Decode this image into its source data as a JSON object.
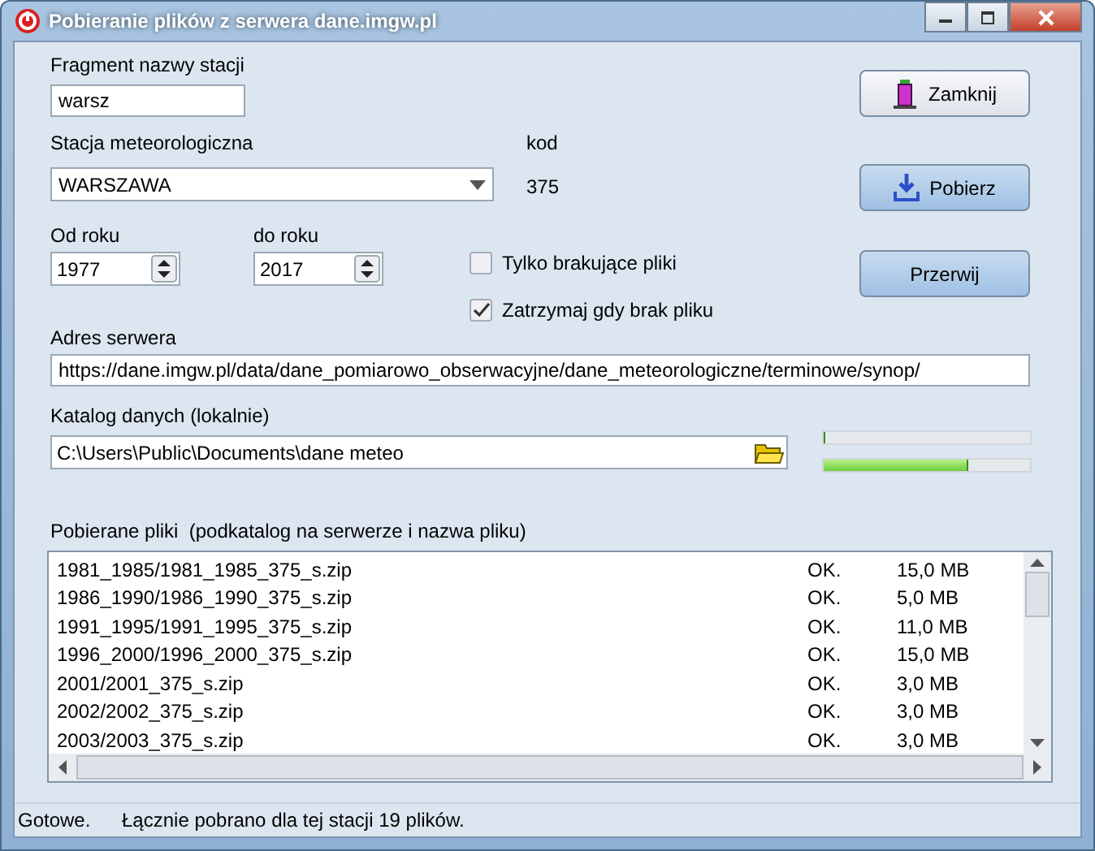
{
  "window": {
    "title": "Pobieranie plików z serwera dane.imgw.pl"
  },
  "station_filter": {
    "label": "Fragment nazwy stacji",
    "value": "warsz"
  },
  "station": {
    "label": "Stacja meteorologiczna",
    "value": "WARSZAWA"
  },
  "code": {
    "label": "kod",
    "value": "375"
  },
  "from_year": {
    "label": "Od roku",
    "value": "1977"
  },
  "to_year": {
    "label": "do roku",
    "value": "2017"
  },
  "options": [
    {
      "label": "Tylko brakujące pliki",
      "checked": false
    },
    {
      "label": "Zatrzymaj gdy brak pliku",
      "checked": true
    }
  ],
  "buttons": [
    {
      "label": "Zamknij",
      "kind": "close"
    },
    {
      "label": "Pobierz",
      "kind": "download"
    },
    {
      "label": "Przerwij",
      "kind": "stop"
    }
  ],
  "server": {
    "label": "Adres serwera",
    "value": "https://dane.imgw.pl/data/dane_pomiarowo_obserwacyjne/dane_meteorologiczne/terminowe/synop/"
  },
  "local_dir": {
    "label": "Katalog danych (lokalnie)",
    "value": "C:\\Users\\Public\\Documents\\dane meteo"
  },
  "progress": [
    {
      "level": 0
    },
    {
      "level": 0.7
    }
  ],
  "files": {
    "label": "Pobierane pliki  (podkatalog na serwerze i nazwa pliku)",
    "rows": [
      {
        "name": "1981_1985/1981_1985_375_s.zip",
        "status": "OK.",
        "size": "15,0 MB"
      },
      {
        "name": "1986_1990/1986_1990_375_s.zip",
        "status": "OK.",
        "size": "5,0 MB"
      },
      {
        "name": "1991_1995/1991_1995_375_s.zip",
        "status": "OK.",
        "size": "11,0 MB"
      },
      {
        "name": "1996_2000/1996_2000_375_s.zip",
        "status": "OK.",
        "size": "15,0 MB"
      },
      {
        "name": "2001/2001_375_s.zip",
        "status": "OK.",
        "size": "3,0 MB"
      },
      {
        "name": "2002/2002_375_s.zip",
        "status": "OK.",
        "size": "3,0 MB"
      },
      {
        "name": "2003/2003_375_s.zip",
        "status": "OK.",
        "size": "3,0 MB"
      }
    ]
  },
  "status_bar": [
    "Gotowe.",
    "Łącznie pobrano dla tej stacji 19 plików."
  ]
}
